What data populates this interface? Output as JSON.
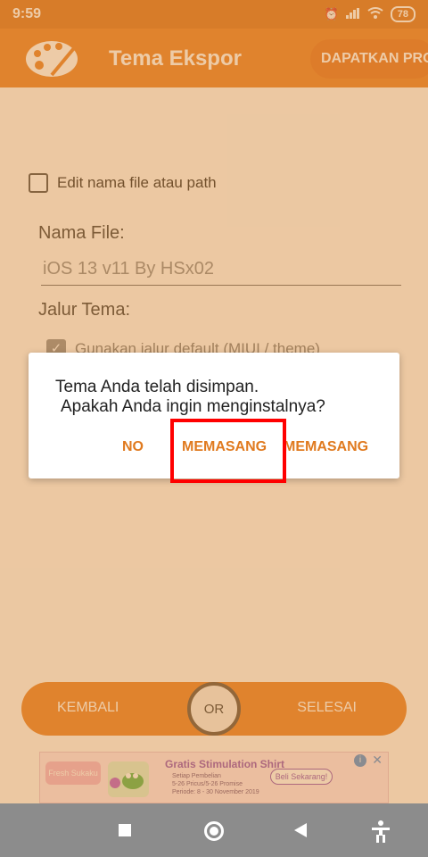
{
  "status_bar": {
    "time": "9:59",
    "battery": "78"
  },
  "app_bar": {
    "title": "Tema Ekspor",
    "pro_label": "DAPATKAN PRO"
  },
  "form": {
    "edit_checkbox_label": "Edit nama file atau path",
    "file_name_label": "Nama File:",
    "file_name_value": "iOS 13 v11 By HSx02",
    "theme_path_label": "Jalur Tema:",
    "default_path_label": "Gunakan jalur default (MIUI / theme)"
  },
  "bottom_bar": {
    "back_label": "KEMBALI",
    "or_label": "OR",
    "done_label": "SELESAI"
  },
  "ad": {
    "brand": "Fresh Sukaku",
    "headline": "Gratis Stimulation Shirt",
    "body_line1": "Setiap Pembelian",
    "body_line2": "5-26 Pricus/5-26 Promise",
    "period": "Periode: 8 - 30 November 2019",
    "cta": "Beli Sekarang!"
  },
  "dialog": {
    "line1": "Tema Anda telah disimpan.",
    "line2": "Apakah Anda ingin menginstalnya?",
    "no_label": "NO",
    "install_label": "MEMASANG",
    "install_label_2": "MEMASANG"
  },
  "colors": {
    "accent": "#e77d22",
    "dialog_button": "#e07a1f",
    "highlight": "#ff0000"
  }
}
